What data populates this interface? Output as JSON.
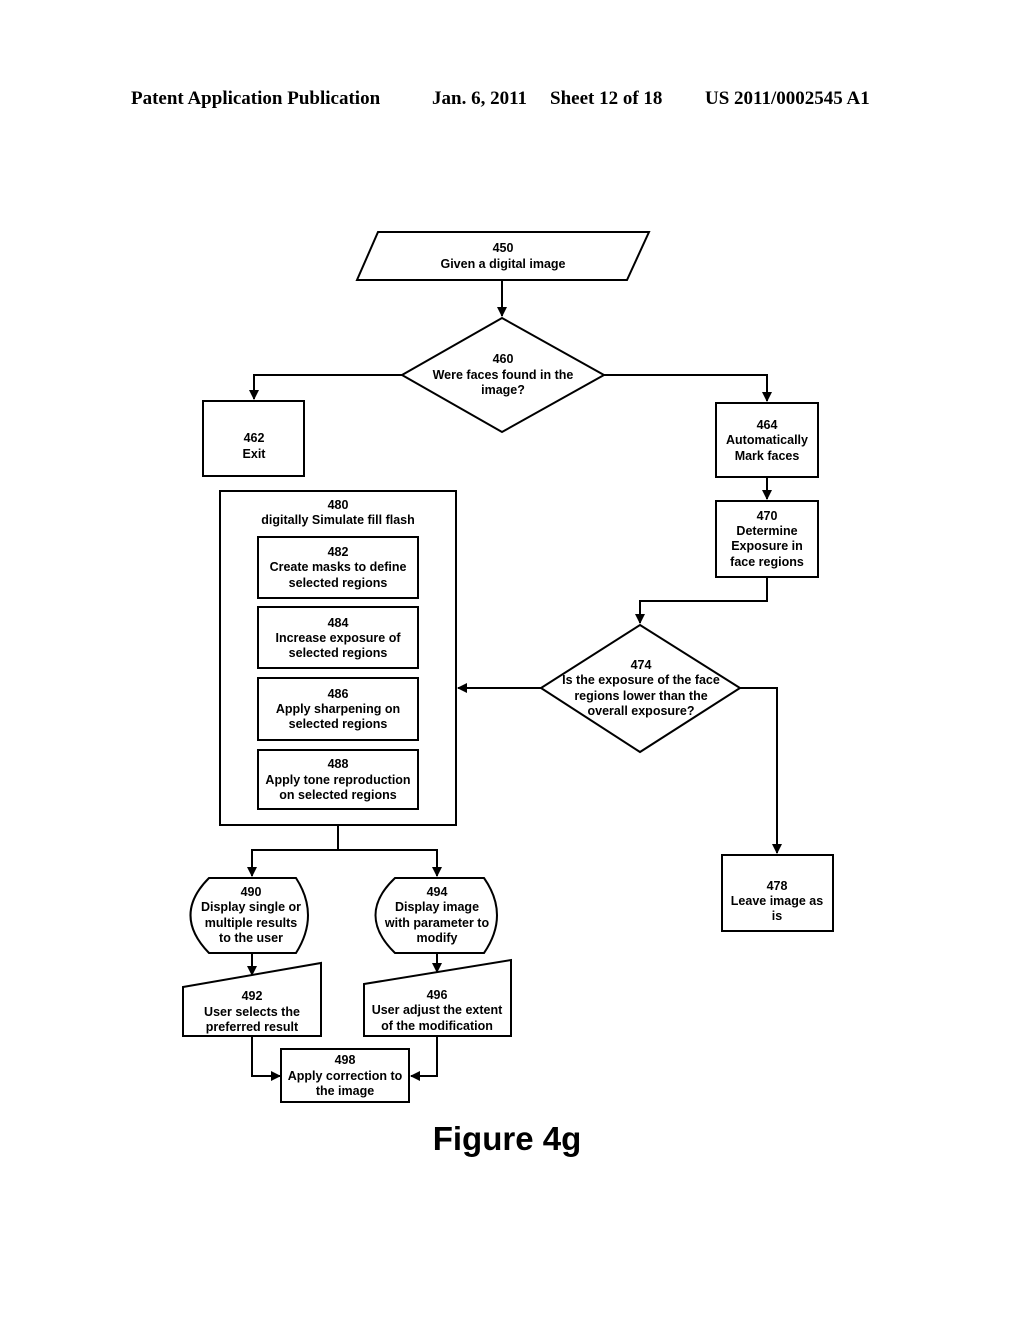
{
  "header": {
    "publication": "Patent Application Publication",
    "date": "Jan. 6, 2011",
    "sheet": "Sheet 12 of 18",
    "document_number": "US 2011/0002545 A1"
  },
  "figure_caption": "Figure 4g",
  "nodes": {
    "n450": {
      "id": "450",
      "lines": [
        "Given a digital image"
      ],
      "shape": "input-parallelogram"
    },
    "n460": {
      "id": "460",
      "lines": [
        "Were faces found in the",
        "image?"
      ],
      "shape": "decision"
    },
    "n462": {
      "id": "462",
      "lines": [
        "Exit"
      ],
      "shape": "process"
    },
    "n464": {
      "id": "464",
      "lines": [
        "Automatically",
        "Mark faces"
      ],
      "shape": "process"
    },
    "n470": {
      "id": "470",
      "lines": [
        "Determine",
        "Exposure in",
        "face regions"
      ],
      "shape": "process"
    },
    "n474": {
      "id": "474",
      "lines": [
        "Is the exposure of the face",
        "regions lower than the",
        "overall exposure?"
      ],
      "shape": "decision"
    },
    "n478": {
      "id": "478",
      "lines": [
        "Leave image as",
        "is"
      ],
      "shape": "process"
    },
    "n480": {
      "id": "480",
      "lines": [
        "digitally Simulate fill flash"
      ],
      "shape": "group"
    },
    "n482": {
      "id": "482",
      "lines": [
        "Create masks to define",
        "selected regions"
      ],
      "shape": "process"
    },
    "n484": {
      "id": "484",
      "lines": [
        "Increase exposure of",
        "selected regions"
      ],
      "shape": "process"
    },
    "n486": {
      "id": "486",
      "lines": [
        "Apply sharpening on",
        "selected regions"
      ],
      "shape": "process"
    },
    "n488": {
      "id": "488",
      "lines": [
        "Apply tone reproduction",
        "on selected regions"
      ],
      "shape": "process"
    },
    "n490": {
      "id": "490",
      "lines": [
        "Display single or",
        "multiple results",
        "to the user"
      ],
      "shape": "display"
    },
    "n494": {
      "id": "494",
      "lines": [
        "Display image",
        "with parameter to",
        "modify"
      ],
      "shape": "display"
    },
    "n492": {
      "id": "492",
      "lines": [
        "User selects the",
        "preferred result"
      ],
      "shape": "manual-input"
    },
    "n496": {
      "id": "496",
      "lines": [
        "User adjust the extent",
        "of the modification"
      ],
      "shape": "manual-input"
    },
    "n498": {
      "id": "498",
      "lines": [
        "Apply correction to",
        "the image"
      ],
      "shape": "process"
    }
  },
  "edges": [
    {
      "from": "450",
      "to": "460"
    },
    {
      "from": "460",
      "to": "462"
    },
    {
      "from": "460",
      "to": "464"
    },
    {
      "from": "464",
      "to": "470"
    },
    {
      "from": "470",
      "to": "474"
    },
    {
      "from": "474",
      "to": "480"
    },
    {
      "from": "474",
      "to": "478"
    },
    {
      "from": "480",
      "to": "490"
    },
    {
      "from": "480",
      "to": "494"
    },
    {
      "from": "490",
      "to": "492"
    },
    {
      "from": "494",
      "to": "496"
    },
    {
      "from": "492",
      "to": "498"
    },
    {
      "from": "496",
      "to": "498"
    }
  ]
}
